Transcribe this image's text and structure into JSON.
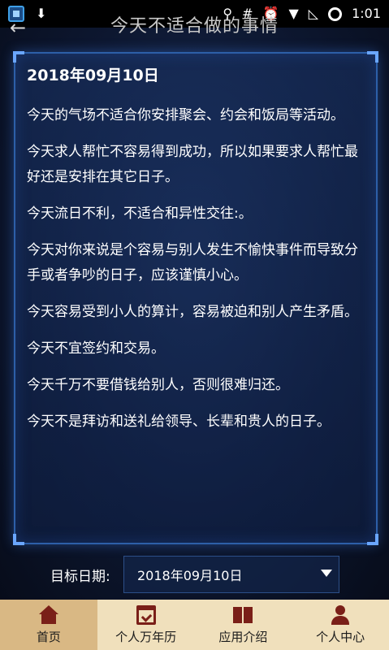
{
  "status": {
    "time": "1:01"
  },
  "header": {
    "title": "今天不适合做的事情",
    "back_glyph": "←"
  },
  "content": {
    "date": "2018年09月10日",
    "paragraphs": [
      "今天的气场不适合你安排聚会、约会和饭局等活动。",
      "今天求人帮忙不容易得到成功，所以如果要求人帮忙最好还是安排在其它日子。",
      "今天流日不利，不适合和异性交往:。",
      "今天对你来说是个容易与别人发生不愉快事件而导致分手或者争吵的日子，应该谨慎小心。",
      "今天容易受到小人的算计，容易被迫和别人产生矛盾。",
      "今天不宜签约和交易。",
      "今天千万不要借钱给别人，否则很难归还。",
      "今天不是拜访和送礼给领导、长辈和贵人的日子。"
    ]
  },
  "target": {
    "label": "目标日期:",
    "value": "2018年09月10日"
  },
  "nav": [
    {
      "label": "首页",
      "icon": "home-icon"
    },
    {
      "label": "个人万年历",
      "icon": "calendar-icon"
    },
    {
      "label": "应用介绍",
      "icon": "book-icon"
    },
    {
      "label": "个人中心",
      "icon": "user-icon"
    }
  ],
  "colors": {
    "accent": "#7a1f18",
    "nav_bg": "#f0e0bc",
    "nav_active": "#d9b884",
    "panel_border": "#2d5fa8"
  }
}
